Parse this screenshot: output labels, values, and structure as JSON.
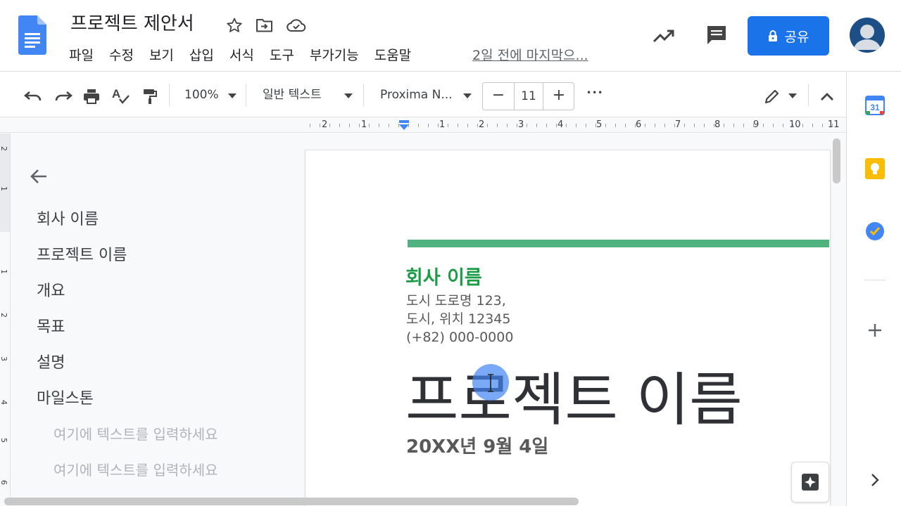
{
  "header": {
    "doc_title": "프로젝트 제안서",
    "menu": [
      "파일",
      "수정",
      "보기",
      "삽입",
      "서식",
      "도구",
      "부가기능",
      "도움말"
    ],
    "last_edit": "2일 전에 마지막으...",
    "share_label": "공유",
    "icons": {
      "star": "star-icon",
      "move": "move-to-folder-icon",
      "cloud": "cloud-status-icon",
      "activity": "activity-trend-icon",
      "comments": "comment-icon",
      "lock": "lock-icon",
      "avatar": "account-avatar"
    }
  },
  "toolbar": {
    "zoom": "100%",
    "style": "일반 텍스트",
    "font": "Proxima N...",
    "font_size": "11",
    "minus": "−",
    "plus": "+",
    "more": "•••"
  },
  "ruler": {
    "labels": [
      "2",
      "1",
      "1",
      "2",
      "3",
      "4",
      "5",
      "6",
      "7",
      "8",
      "9",
      "10",
      "11"
    ]
  },
  "vertical_ruler": {
    "labels": [
      "2",
      "1",
      "1",
      "2",
      "3",
      "4",
      "5",
      "6"
    ]
  },
  "outline": {
    "items": [
      "회사 이름",
      "프로젝트 이름",
      "개요",
      "목표",
      "설명",
      "마일스톤"
    ],
    "sub_items": [
      "여기에 텍스트를 입력하세요",
      "여기에 텍스트를 입력하세요"
    ]
  },
  "document": {
    "company": "회사 이름",
    "address": [
      "도시 도로명 123,",
      "도시, 위치 12345",
      "(+82) 000-0000"
    ],
    "project_title": "프로젝트 이름",
    "date": "20XX년 9월 4일"
  },
  "colors": {
    "accent_green": "#1b9d47",
    "bar_green": "#50b37f",
    "share_blue": "#1a73e8"
  }
}
